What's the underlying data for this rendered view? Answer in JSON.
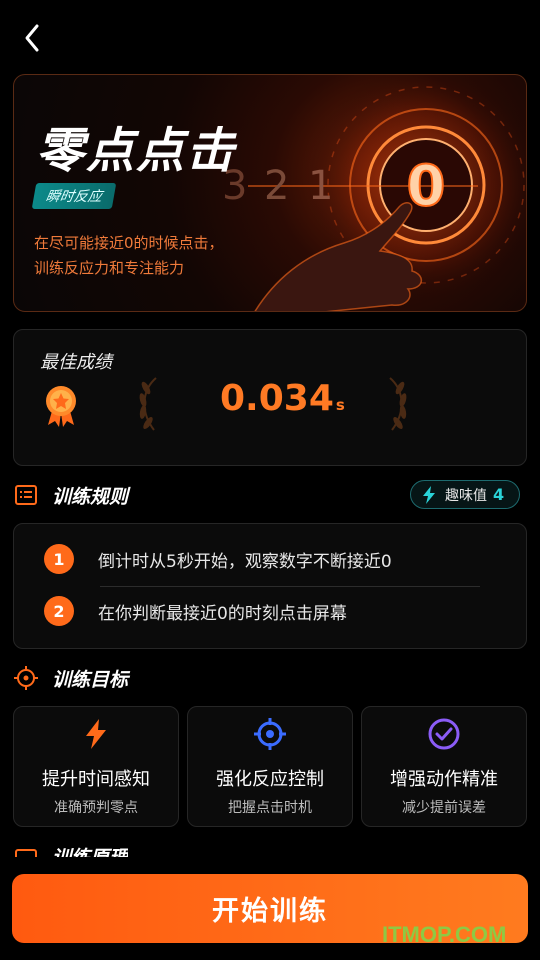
{
  "hero": {
    "title": "零点点击",
    "tag": "瞬时反应",
    "desc_line1": "在尽可能接近0的时候点击，",
    "desc_line2": "训练反应力和专注能力",
    "countdown": [
      "3",
      "2",
      "1",
      "0"
    ]
  },
  "best": {
    "label": "最佳成绩",
    "value": "0.034",
    "unit": "s"
  },
  "rules_section": {
    "title": "训练规则",
    "fun_label": "趣味值",
    "fun_value": "4",
    "items": [
      {
        "num": "1",
        "text": "倒计时从5秒开始，观察数字不断接近0"
      },
      {
        "num": "2",
        "text": "在你判断最接近0的时刻点击屏幕"
      }
    ]
  },
  "goals_section": {
    "title": "训练目标",
    "items": [
      {
        "icon": "lightning-icon",
        "title": "提升时间感知",
        "sub": "准确预判零点",
        "color": "#ff6a1a"
      },
      {
        "icon": "crosshair-icon",
        "title": "强化反应控制",
        "sub": "把握点击时机",
        "color": "#3b6cff"
      },
      {
        "icon": "check-circle-icon",
        "title": "增强动作精准",
        "sub": "减少提前误差",
        "color": "#8b5cf6"
      }
    ]
  },
  "principle_section": {
    "title": "训练原理"
  },
  "start_button": "开始训练",
  "watermark": "ITMOP.COM"
}
